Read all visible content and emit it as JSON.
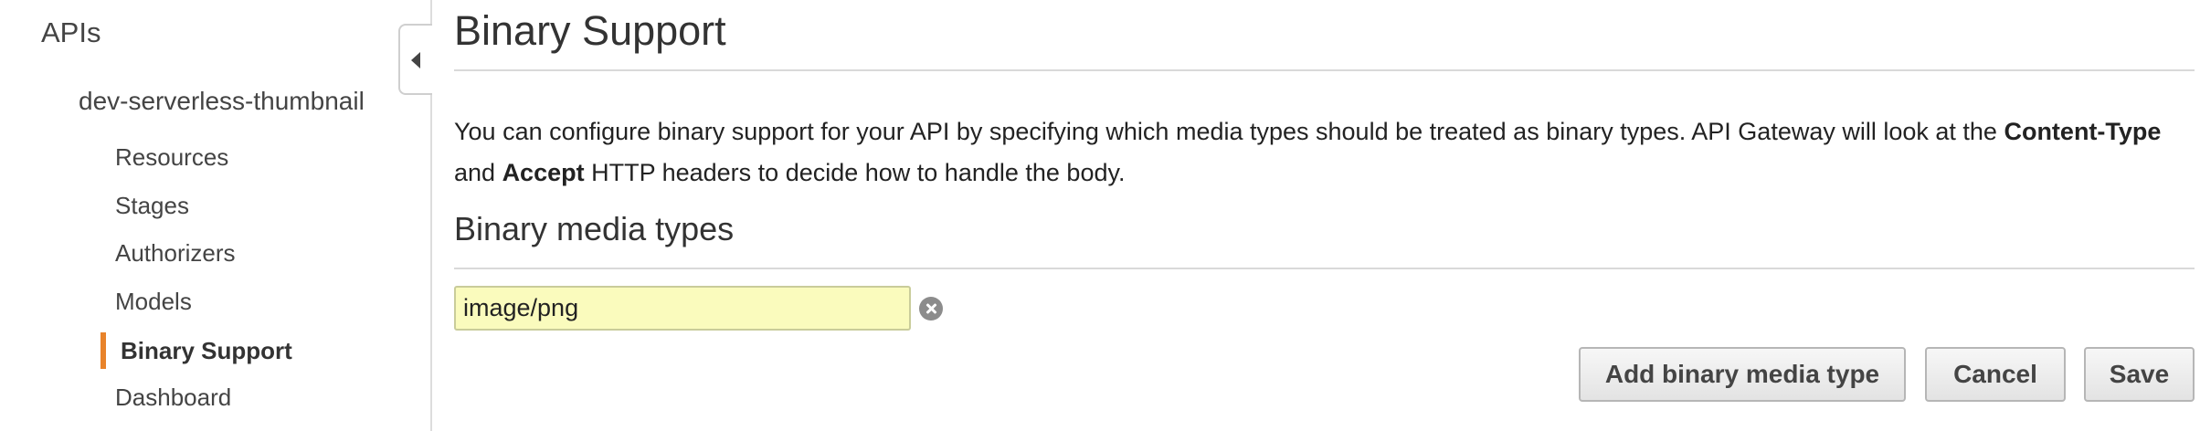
{
  "sidebar": {
    "apis_label": "APIs",
    "api_name": "dev-serverless-thumbnail",
    "items": [
      {
        "label": "Resources"
      },
      {
        "label": "Stages"
      },
      {
        "label": "Authorizers"
      },
      {
        "label": "Models"
      },
      {
        "label": "Binary Support",
        "active": true
      },
      {
        "label": "Dashboard"
      }
    ],
    "active_color": "#e8832a"
  },
  "main": {
    "title": "Binary Support",
    "description": {
      "part1": "You can configure binary support for your API by specifying which media types should be treated as binary types. API Gateway will look at the ",
      "bold1": "Content-Type",
      "part2": " and ",
      "bold2": "Accept",
      "part3": " HTTP headers to decide how to handle the body."
    },
    "section_title": "Binary media types",
    "media_types": [
      {
        "value": "image/png"
      }
    ],
    "buttons": {
      "add": "Add binary media type",
      "cancel": "Cancel",
      "save": "Save"
    }
  },
  "icons": {
    "collapse": "chevron-left-icon",
    "remove": "remove-circle-icon"
  }
}
